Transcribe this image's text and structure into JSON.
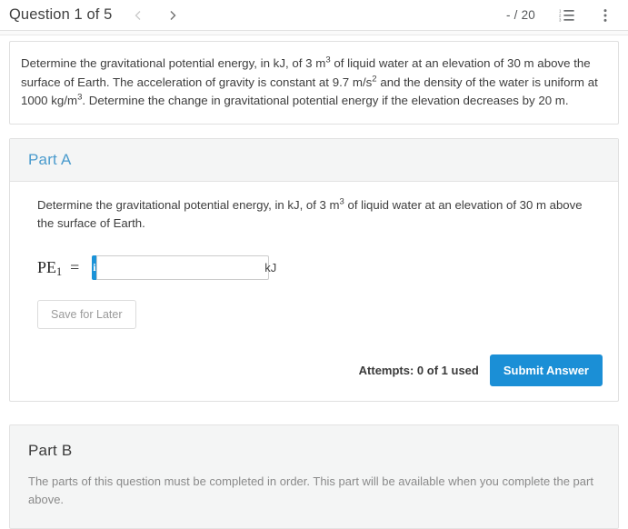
{
  "header": {
    "question_title": "Question 1 of 5",
    "prev_icon": "chevron-left-icon",
    "next_icon": "chevron-right-icon",
    "score": "- / 20",
    "list_icon": "ordered-list-icon",
    "menu_icon": "kebab-menu-icon"
  },
  "statement": {
    "line1": "Determine the gravitational potential energy, in kJ, of 3 m",
    "sup1": "3",
    "line2": " of liquid water at an elevation of 30 m above the surface of Earth. The acceleration of gravity is constant at 9.7 m/s",
    "sup2": "2",
    "line3": " and the density of the water is uniform at 1000 kg/m",
    "sup3": "3",
    "line4": ". Determine the change in gravitational potential energy if the elevation decreases by 20 m."
  },
  "part_a": {
    "title": "Part A",
    "question_line1": "Determine the gravitational potential energy, in kJ, of 3 m",
    "question_sup": "3",
    "question_line2": " of liquid water at an elevation of 30 m above the surface of Earth.",
    "variable_label": "PE",
    "variable_subscript": "1",
    "equals": "=",
    "info_icon": "info-icon",
    "info_glyph": "i",
    "answer_value": "",
    "answer_placeholder": "",
    "unit": "kJ",
    "save_label": "Save for Later",
    "attempts": "Attempts: 0 of 1 used",
    "submit_label": "Submit Answer"
  },
  "part_b": {
    "title": "Part B",
    "locked_message": "The parts of this question must be completed in order. This part will be available when you complete the part above."
  },
  "colors": {
    "accent_blue": "#1b8fd6",
    "info_blue": "#1b93d8",
    "part_title_blue": "#4a9bcd",
    "panel_gray": "#f4f5f5",
    "border_gray": "#e0e0e0",
    "muted_text": "#8a8a8a"
  }
}
